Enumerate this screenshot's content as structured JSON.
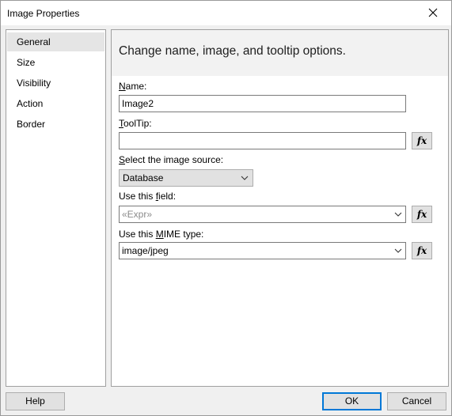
{
  "window": {
    "title": "Image Properties"
  },
  "nav": {
    "items": [
      {
        "label": "General",
        "selected": true
      },
      {
        "label": "Size",
        "selected": false
      },
      {
        "label": "Visibility",
        "selected": false
      },
      {
        "label": "Action",
        "selected": false
      },
      {
        "label": "Border",
        "selected": false
      }
    ]
  },
  "main": {
    "header": "Change name, image, and tooltip options.",
    "name": {
      "label_pre": "",
      "label_ul": "N",
      "label_post": "ame:",
      "value": "Image2"
    },
    "tooltip": {
      "label_pre": "",
      "label_ul": "T",
      "label_post": "oolTip:",
      "value": ""
    },
    "image_source": {
      "label_pre": "",
      "label_ul": "S",
      "label_post": "elect the image source:",
      "selected": "Database"
    },
    "field": {
      "label_pre": "Use this ",
      "label_ul": "f",
      "label_post": "ield:",
      "value": "«Expr»"
    },
    "mime": {
      "label_pre": "Use this ",
      "label_ul": "M",
      "label_post": "IME type:",
      "value": "image/jpeg"
    },
    "fx_label": "fx"
  },
  "footer": {
    "help": "Help",
    "ok": "OK",
    "cancel": "Cancel"
  },
  "colors": {
    "accent": "#0078d7",
    "header_bg": "#f2f2f2",
    "selected_nav": "#e5e5e5"
  }
}
